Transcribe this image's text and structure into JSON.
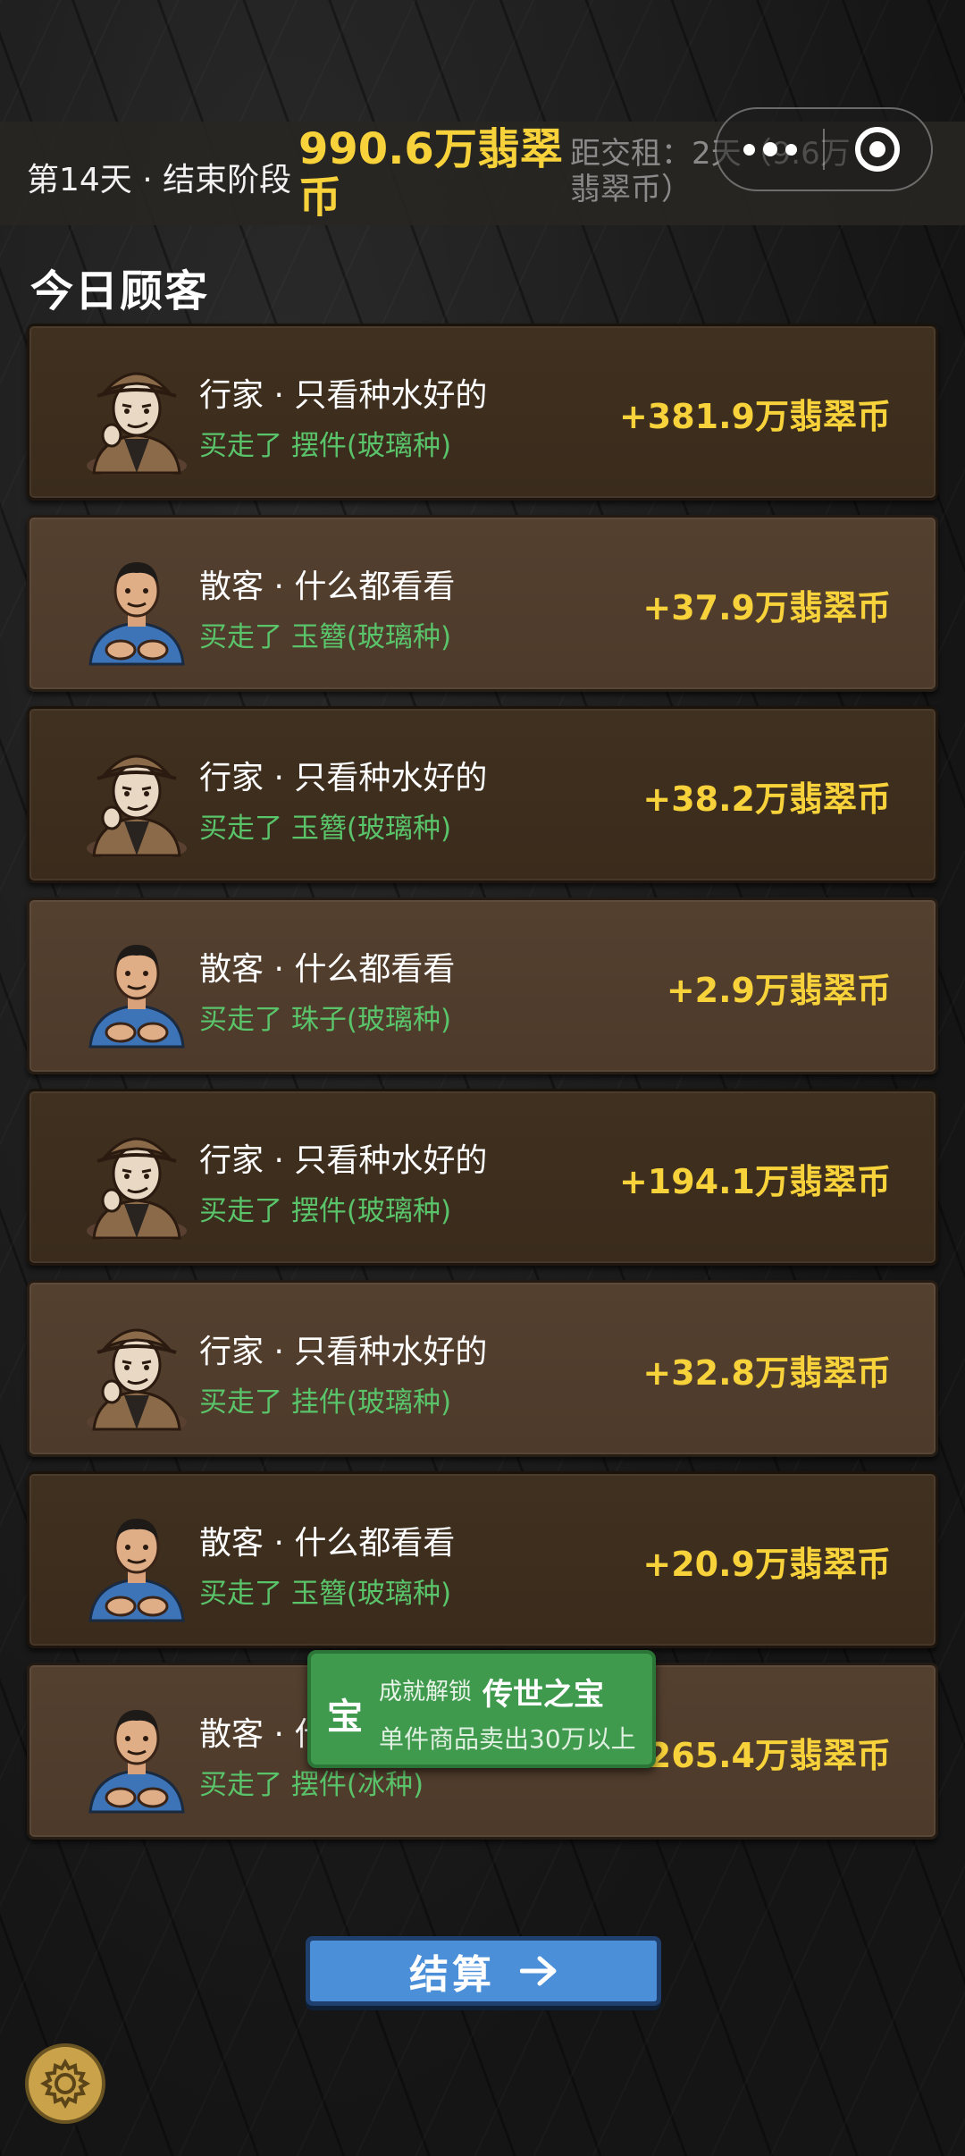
{
  "topbar": {
    "day": "第14天 · 结束阶段",
    "coins": "990.6万翡翠币",
    "rent": "距交租：2天（9.6万翡翠币）"
  },
  "section_title": "今日顾客",
  "customers": [
    {
      "type": "expert",
      "name": "行家 · 只看种水好的",
      "bought": "买走了  摆件(玻璃种)",
      "gain": "+381.9万翡翠币"
    },
    {
      "type": "casual",
      "name": "散客 · 什么都看看",
      "bought": "买走了  玉簪(玻璃种)",
      "gain": "+37.9万翡翠币"
    },
    {
      "type": "expert",
      "name": "行家 · 只看种水好的",
      "bought": "买走了  玉簪(玻璃种)",
      "gain": "+38.2万翡翠币"
    },
    {
      "type": "casual",
      "name": "散客 · 什么都看看",
      "bought": "买走了  珠子(玻璃种)",
      "gain": "+2.9万翡翠币"
    },
    {
      "type": "expert",
      "name": "行家 · 只看种水好的",
      "bought": "买走了  摆件(玻璃种)",
      "gain": "+194.1万翡翠币"
    },
    {
      "type": "expert",
      "name": "行家 · 只看种水好的",
      "bought": "买走了  挂件(玻璃种)",
      "gain": "+32.8万翡翠币"
    },
    {
      "type": "casual",
      "name": "散客 · 什么都看看",
      "bought": "买走了  玉簪(玻璃种)",
      "gain": "+20.9万翡翠币"
    },
    {
      "type": "casual",
      "name": "散客 · 什么都看看",
      "bought": "买走了  摆件(冰种)",
      "gain": "+265.4万翡翠币"
    }
  ],
  "toast": {
    "badge": "宝",
    "tag": "成就解锁",
    "title": "传世之宝",
    "desc": "单件商品卖出30万以上"
  },
  "settle_label": "结算"
}
